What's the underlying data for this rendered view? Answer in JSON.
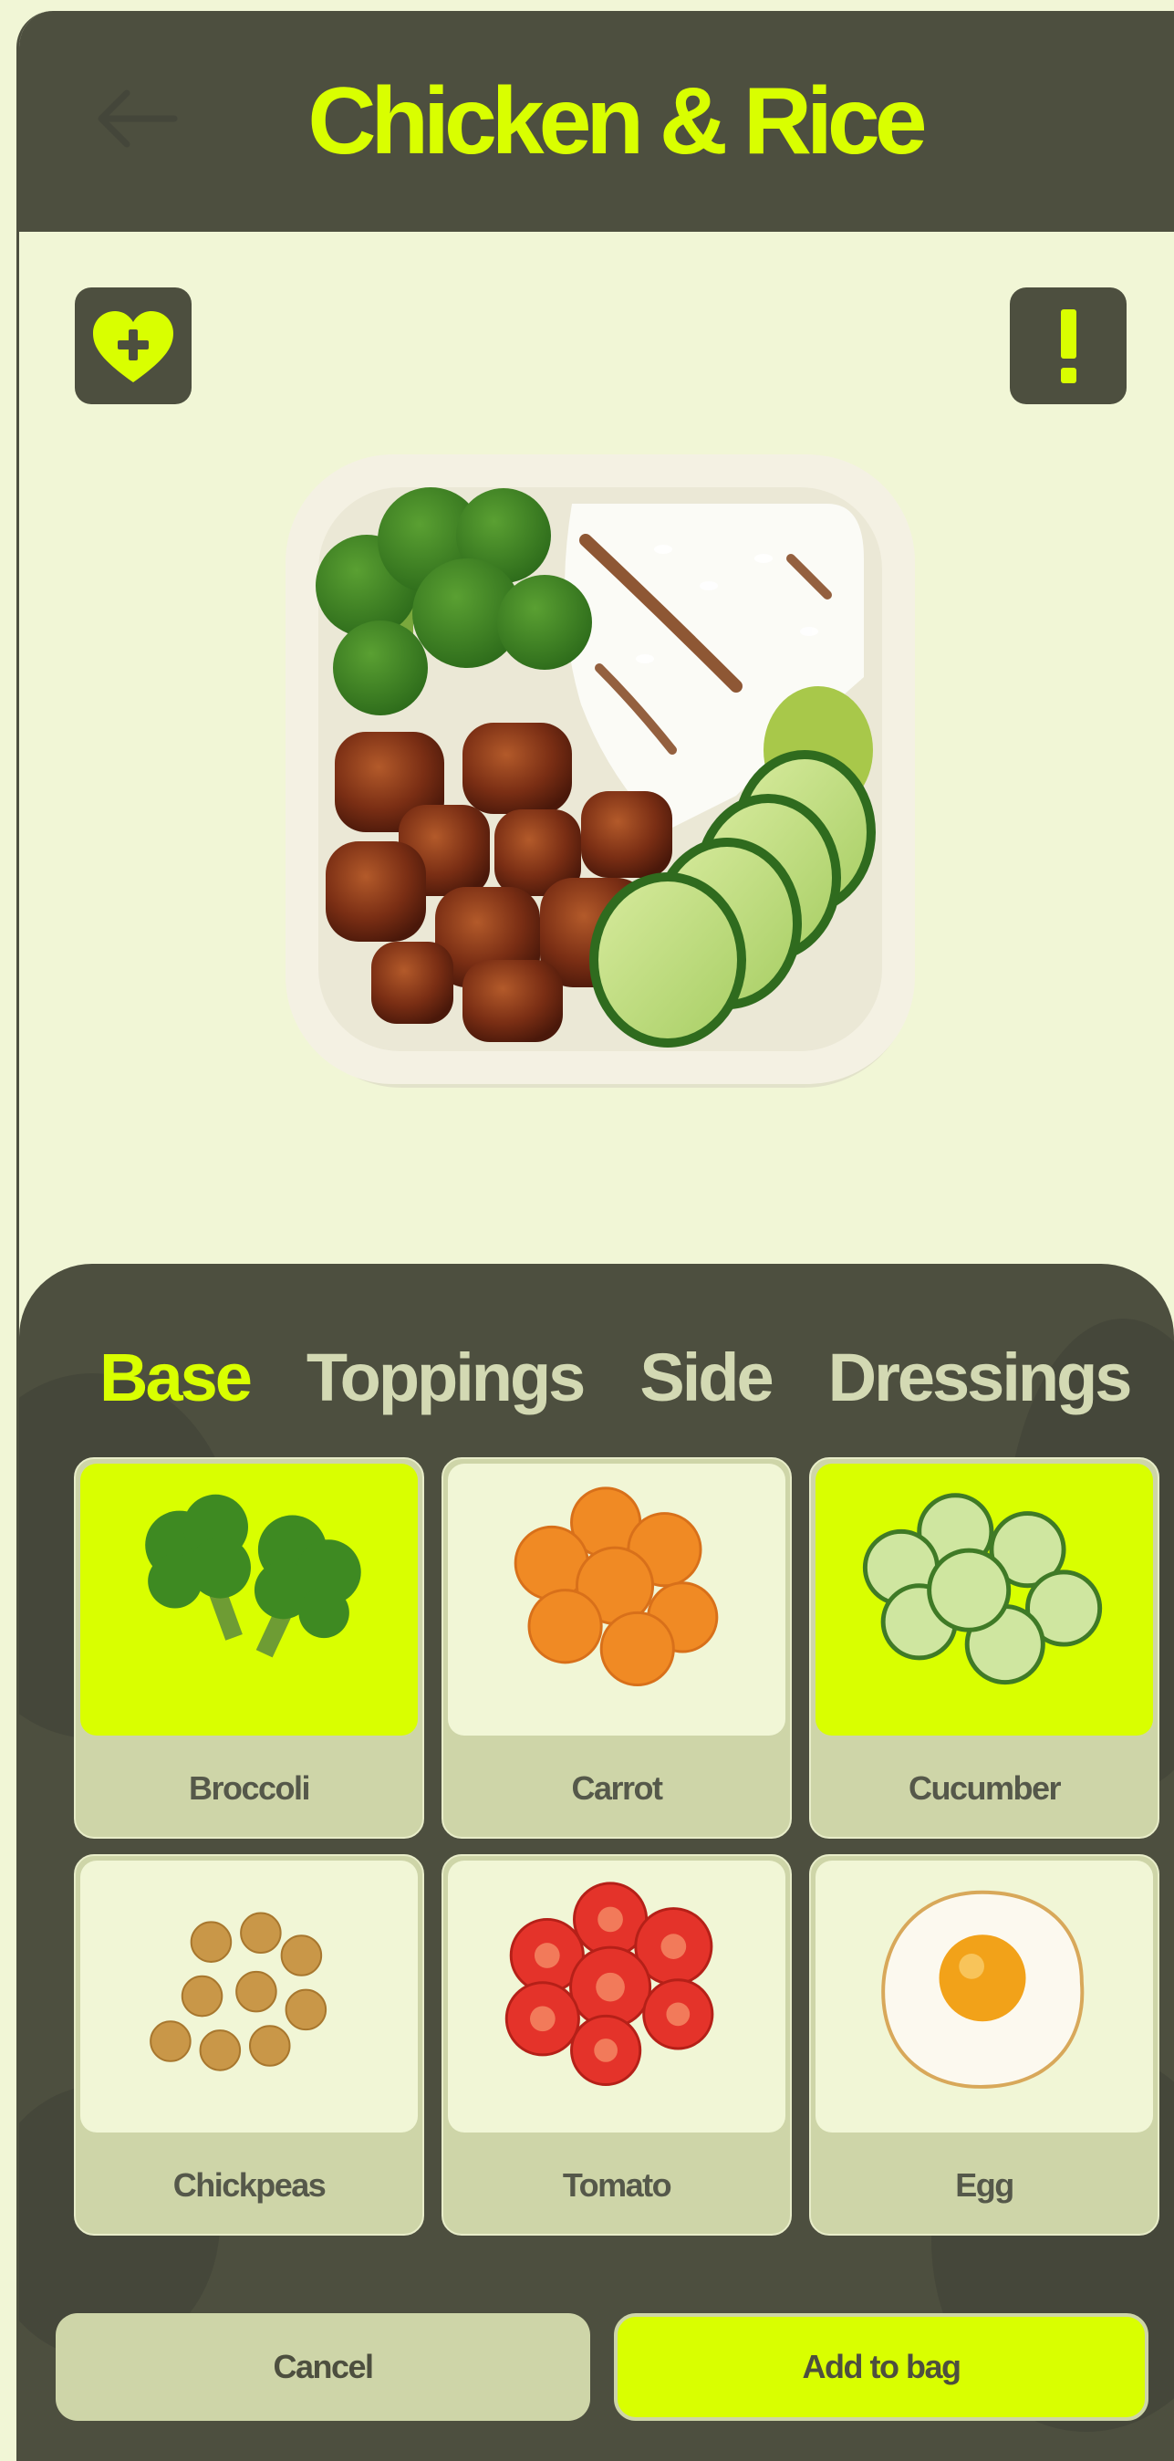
{
  "header": {
    "title": "Chicken & Rice"
  },
  "icons": {
    "back": "back-arrow-icon",
    "favorite": "heart-plus-icon",
    "alert": "exclamation-icon"
  },
  "tabs": [
    {
      "label": "Base",
      "active": true
    },
    {
      "label": "Toppings",
      "active": false
    },
    {
      "label": "Side",
      "active": false
    },
    {
      "label": "Dressings",
      "active": false
    }
  ],
  "ingredients": [
    {
      "label": "Broccoli",
      "selected": true
    },
    {
      "label": "Carrot",
      "selected": false
    },
    {
      "label": "Cucumber",
      "selected": true
    },
    {
      "label": "Chickpeas",
      "selected": false
    },
    {
      "label": "Tomato",
      "selected": false
    },
    {
      "label": "Egg",
      "selected": false
    }
  ],
  "actions": {
    "cancel": "Cancel",
    "add": "Add to bag"
  },
  "colors": {
    "accent": "#d9ff00",
    "dark": "#4d4f3f",
    "background": "#f1f6d6",
    "card": "#ced5a8"
  }
}
